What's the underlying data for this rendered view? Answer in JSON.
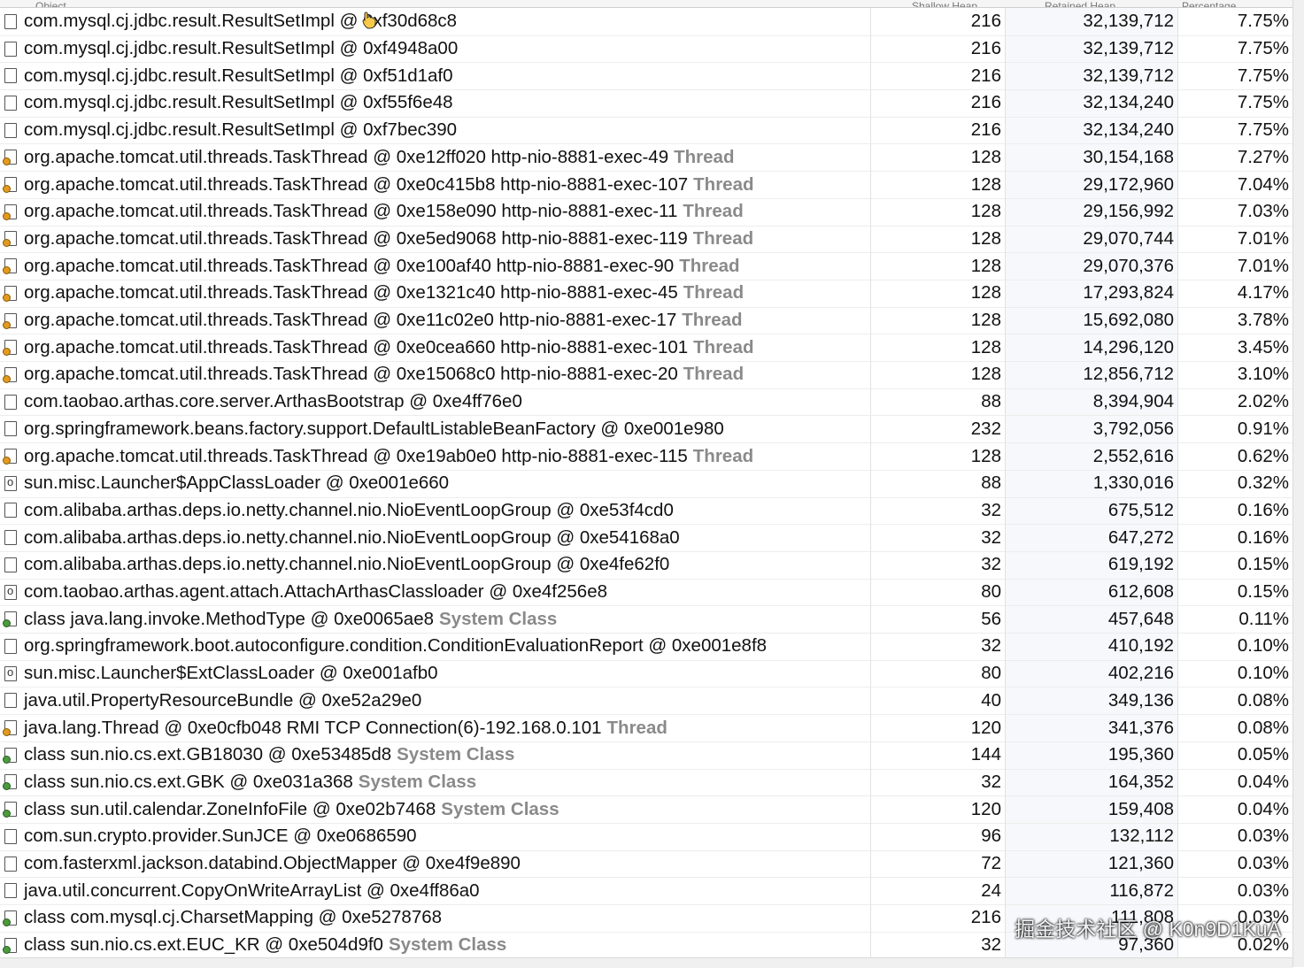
{
  "header": {
    "col_object": "Object",
    "col_shallow": "Shallow Heap",
    "col_retained": "Retained Heap",
    "col_percent": "Percentage"
  },
  "rows": [
    {
      "icon": "object",
      "name": "com.mysql.cj.jdbc.result.ResultSetImpl @ 0xf30d68c8",
      "suffix": "",
      "shallow": "216",
      "retained": "32,139,712",
      "percent": "7.75%"
    },
    {
      "icon": "object",
      "name": "com.mysql.cj.jdbc.result.ResultSetImpl @ 0xf4948a00",
      "suffix": "",
      "shallow": "216",
      "retained": "32,139,712",
      "percent": "7.75%"
    },
    {
      "icon": "object",
      "name": "com.mysql.cj.jdbc.result.ResultSetImpl @ 0xf51d1af0",
      "suffix": "",
      "shallow": "216",
      "retained": "32,139,712",
      "percent": "7.75%"
    },
    {
      "icon": "object",
      "name": "com.mysql.cj.jdbc.result.ResultSetImpl @ 0xf55f6e48",
      "suffix": "",
      "shallow": "216",
      "retained": "32,134,240",
      "percent": "7.75%"
    },
    {
      "icon": "object",
      "name": "com.mysql.cj.jdbc.result.ResultSetImpl @ 0xf7bec390",
      "suffix": "",
      "shallow": "216",
      "retained": "32,134,240",
      "percent": "7.75%"
    },
    {
      "icon": "thread",
      "name": "org.apache.tomcat.util.threads.TaskThread @ 0xe12ff020  http-nio-8881-exec-49",
      "suffix": "Thread",
      "shallow": "128",
      "retained": "30,154,168",
      "percent": "7.27%"
    },
    {
      "icon": "thread",
      "name": "org.apache.tomcat.util.threads.TaskThread @ 0xe0c415b8  http-nio-8881-exec-107",
      "suffix": "Thread",
      "shallow": "128",
      "retained": "29,172,960",
      "percent": "7.04%"
    },
    {
      "icon": "thread",
      "name": "org.apache.tomcat.util.threads.TaskThread @ 0xe158e090  http-nio-8881-exec-11",
      "suffix": "Thread",
      "shallow": "128",
      "retained": "29,156,992",
      "percent": "7.03%"
    },
    {
      "icon": "thread",
      "name": "org.apache.tomcat.util.threads.TaskThread @ 0xe5ed9068  http-nio-8881-exec-119",
      "suffix": "Thread",
      "shallow": "128",
      "retained": "29,070,744",
      "percent": "7.01%"
    },
    {
      "icon": "thread",
      "name": "org.apache.tomcat.util.threads.TaskThread @ 0xe100af40  http-nio-8881-exec-90",
      "suffix": "Thread",
      "shallow": "128",
      "retained": "29,070,376",
      "percent": "7.01%"
    },
    {
      "icon": "thread",
      "name": "org.apache.tomcat.util.threads.TaskThread @ 0xe1321c40  http-nio-8881-exec-45",
      "suffix": "Thread",
      "shallow": "128",
      "retained": "17,293,824",
      "percent": "4.17%"
    },
    {
      "icon": "thread",
      "name": "org.apache.tomcat.util.threads.TaskThread @ 0xe11c02e0  http-nio-8881-exec-17",
      "suffix": "Thread",
      "shallow": "128",
      "retained": "15,692,080",
      "percent": "3.78%"
    },
    {
      "icon": "thread",
      "name": "org.apache.tomcat.util.threads.TaskThread @ 0xe0cea660  http-nio-8881-exec-101",
      "suffix": "Thread",
      "shallow": "128",
      "retained": "14,296,120",
      "percent": "3.45%"
    },
    {
      "icon": "thread",
      "name": "org.apache.tomcat.util.threads.TaskThread @ 0xe15068c0  http-nio-8881-exec-20",
      "suffix": "Thread",
      "shallow": "128",
      "retained": "12,856,712",
      "percent": "3.10%"
    },
    {
      "icon": "object",
      "name": "com.taobao.arthas.core.server.ArthasBootstrap @ 0xe4ff76e0",
      "suffix": "",
      "shallow": "88",
      "retained": "8,394,904",
      "percent": "2.02%"
    },
    {
      "icon": "object",
      "name": "org.springframework.beans.factory.support.DefaultListableBeanFactory @ 0xe001e980",
      "suffix": "",
      "shallow": "232",
      "retained": "3,792,056",
      "percent": "0.91%"
    },
    {
      "icon": "thread",
      "name": "org.apache.tomcat.util.threads.TaskThread @ 0xe19ab0e0  http-nio-8881-exec-115",
      "suffix": "Thread",
      "shallow": "128",
      "retained": "2,552,616",
      "percent": "0.62%"
    },
    {
      "icon": "loader",
      "name": "sun.misc.Launcher$AppClassLoader @ 0xe001e660",
      "suffix": "",
      "shallow": "88",
      "retained": "1,330,016",
      "percent": "0.32%"
    },
    {
      "icon": "object",
      "name": "com.alibaba.arthas.deps.io.netty.channel.nio.NioEventLoopGroup @ 0xe53f4cd0",
      "suffix": "",
      "shallow": "32",
      "retained": "675,512",
      "percent": "0.16%"
    },
    {
      "icon": "object",
      "name": "com.alibaba.arthas.deps.io.netty.channel.nio.NioEventLoopGroup @ 0xe54168a0",
      "suffix": "",
      "shallow": "32",
      "retained": "647,272",
      "percent": "0.16%"
    },
    {
      "icon": "object",
      "name": "com.alibaba.arthas.deps.io.netty.channel.nio.NioEventLoopGroup @ 0xe4fe62f0",
      "suffix": "",
      "shallow": "32",
      "retained": "619,192",
      "percent": "0.15%"
    },
    {
      "icon": "loader",
      "name": "com.taobao.arthas.agent.attach.AttachArthasClassloader @ 0xe4f256e8",
      "suffix": "",
      "shallow": "80",
      "retained": "612,608",
      "percent": "0.15%"
    },
    {
      "icon": "classobj",
      "name": "class java.lang.invoke.MethodType @ 0xe0065ae8",
      "suffix": "System Class",
      "shallow": "56",
      "retained": "457,648",
      "percent": "0.11%"
    },
    {
      "icon": "object",
      "name": "org.springframework.boot.autoconfigure.condition.ConditionEvaluationReport @ 0xe001e8f8",
      "suffix": "",
      "shallow": "32",
      "retained": "410,192",
      "percent": "0.10%"
    },
    {
      "icon": "loader",
      "name": "sun.misc.Launcher$ExtClassLoader @ 0xe001afb0",
      "suffix": "",
      "shallow": "80",
      "retained": "402,216",
      "percent": "0.10%"
    },
    {
      "icon": "object",
      "name": "java.util.PropertyResourceBundle @ 0xe52a29e0",
      "suffix": "",
      "shallow": "40",
      "retained": "349,136",
      "percent": "0.08%"
    },
    {
      "icon": "thread",
      "name": "java.lang.Thread @ 0xe0cfb048  RMI TCP Connection(6)-192.168.0.101",
      "suffix": "Thread",
      "shallow": "120",
      "retained": "341,376",
      "percent": "0.08%"
    },
    {
      "icon": "classobj",
      "name": "class sun.nio.cs.ext.GB18030 @ 0xe53485d8",
      "suffix": "System Class",
      "shallow": "144",
      "retained": "195,360",
      "percent": "0.05%"
    },
    {
      "icon": "classobj",
      "name": "class sun.nio.cs.ext.GBK @ 0xe031a368",
      "suffix": "System Class",
      "shallow": "32",
      "retained": "164,352",
      "percent": "0.04%"
    },
    {
      "icon": "classobj",
      "name": "class sun.util.calendar.ZoneInfoFile @ 0xe02b7468",
      "suffix": "System Class",
      "shallow": "120",
      "retained": "159,408",
      "percent": "0.04%"
    },
    {
      "icon": "object",
      "name": "com.sun.crypto.provider.SunJCE @ 0xe0686590",
      "suffix": "",
      "shallow": "96",
      "retained": "132,112",
      "percent": "0.03%"
    },
    {
      "icon": "object",
      "name": "com.fasterxml.jackson.databind.ObjectMapper @ 0xe4f9e890",
      "suffix": "",
      "shallow": "72",
      "retained": "121,360",
      "percent": "0.03%"
    },
    {
      "icon": "object",
      "name": "java.util.concurrent.CopyOnWriteArrayList @ 0xe4ff86a0",
      "suffix": "",
      "shallow": "24",
      "retained": "116,872",
      "percent": "0.03%"
    },
    {
      "icon": "classobj",
      "name": "class com.mysql.cj.CharsetMapping @ 0xe5278768",
      "suffix": "",
      "shallow": "216",
      "retained": "111,808",
      "percent": "0.03%"
    },
    {
      "icon": "classobj",
      "name": "class sun.nio.cs.ext.EUC_KR @ 0xe504d9f0",
      "suffix": "System Class",
      "shallow": "32",
      "retained": "97,360",
      "percent": "0.02%"
    }
  ],
  "watermark": "掘金技术社区 @ K0n9D1KuA"
}
